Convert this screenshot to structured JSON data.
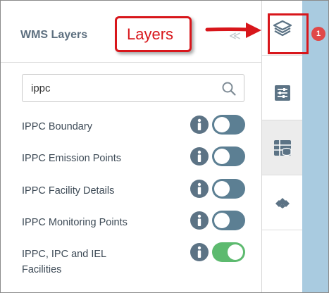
{
  "panel": {
    "title": "WMS Layers",
    "collapse_hint": "≪"
  },
  "callout": {
    "label": "Layers",
    "color": "#d8161b"
  },
  "search": {
    "value": "ippc",
    "icon": "search-icon"
  },
  "layers": [
    {
      "label": "IPPC Boundary",
      "enabled": false
    },
    {
      "label": "IPPC Emission Points",
      "enabled": false
    },
    {
      "label": "IPPC Facility Details",
      "enabled": false
    },
    {
      "label": "IPPC Monitoring Points",
      "enabled": false
    },
    {
      "label": "IPPC, IPC and IEL Facilities",
      "enabled": true
    }
  ],
  "rail": {
    "buttons": [
      {
        "name": "layers-icon",
        "active": true
      },
      {
        "name": "sliders-icon",
        "active": false
      },
      {
        "name": "database-icon",
        "active": false
      },
      {
        "name": "tiles-icon",
        "active": false
      }
    ]
  },
  "badge": {
    "count": "1",
    "color": "#e04848"
  },
  "colors": {
    "toggle_off": "#5c7f93",
    "toggle_on": "#5dba6f",
    "map_water": "#a9cbe0"
  }
}
